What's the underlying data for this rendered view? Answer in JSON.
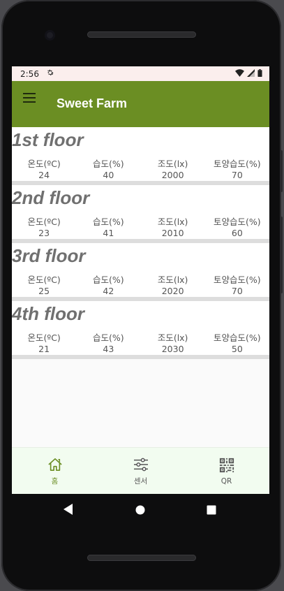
{
  "status": {
    "time": "2:56"
  },
  "app": {
    "title": "Sweet Farm"
  },
  "labels": {
    "temp": "온도(ºC)",
    "humidity": "습도(%)",
    "light": "조도(lx)",
    "soil": "토양습도(%)"
  },
  "floors": [
    {
      "name": "1st floor",
      "temp": "24",
      "humidity": "40",
      "light": "2000",
      "soil": "70"
    },
    {
      "name": "2nd floor",
      "temp": "23",
      "humidity": "41",
      "light": "2010",
      "soil": "60"
    },
    {
      "name": "3rd floor",
      "temp": "25",
      "humidity": "42",
      "light": "2020",
      "soil": "70"
    },
    {
      "name": "4th floor",
      "temp": "21",
      "humidity": "43",
      "light": "2030",
      "soil": "50"
    }
  ],
  "bottom_nav": [
    {
      "label": "홈",
      "icon": "home-icon",
      "active": true
    },
    {
      "label": "센서",
      "icon": "sliders-icon",
      "active": false
    },
    {
      "label": "QR",
      "icon": "qr-code-icon",
      "active": false
    }
  ],
  "colors": {
    "appbar": "#6b8e23",
    "statusbar": "#fbeeed",
    "bottom_nav_bg": "#f2fcf0"
  }
}
